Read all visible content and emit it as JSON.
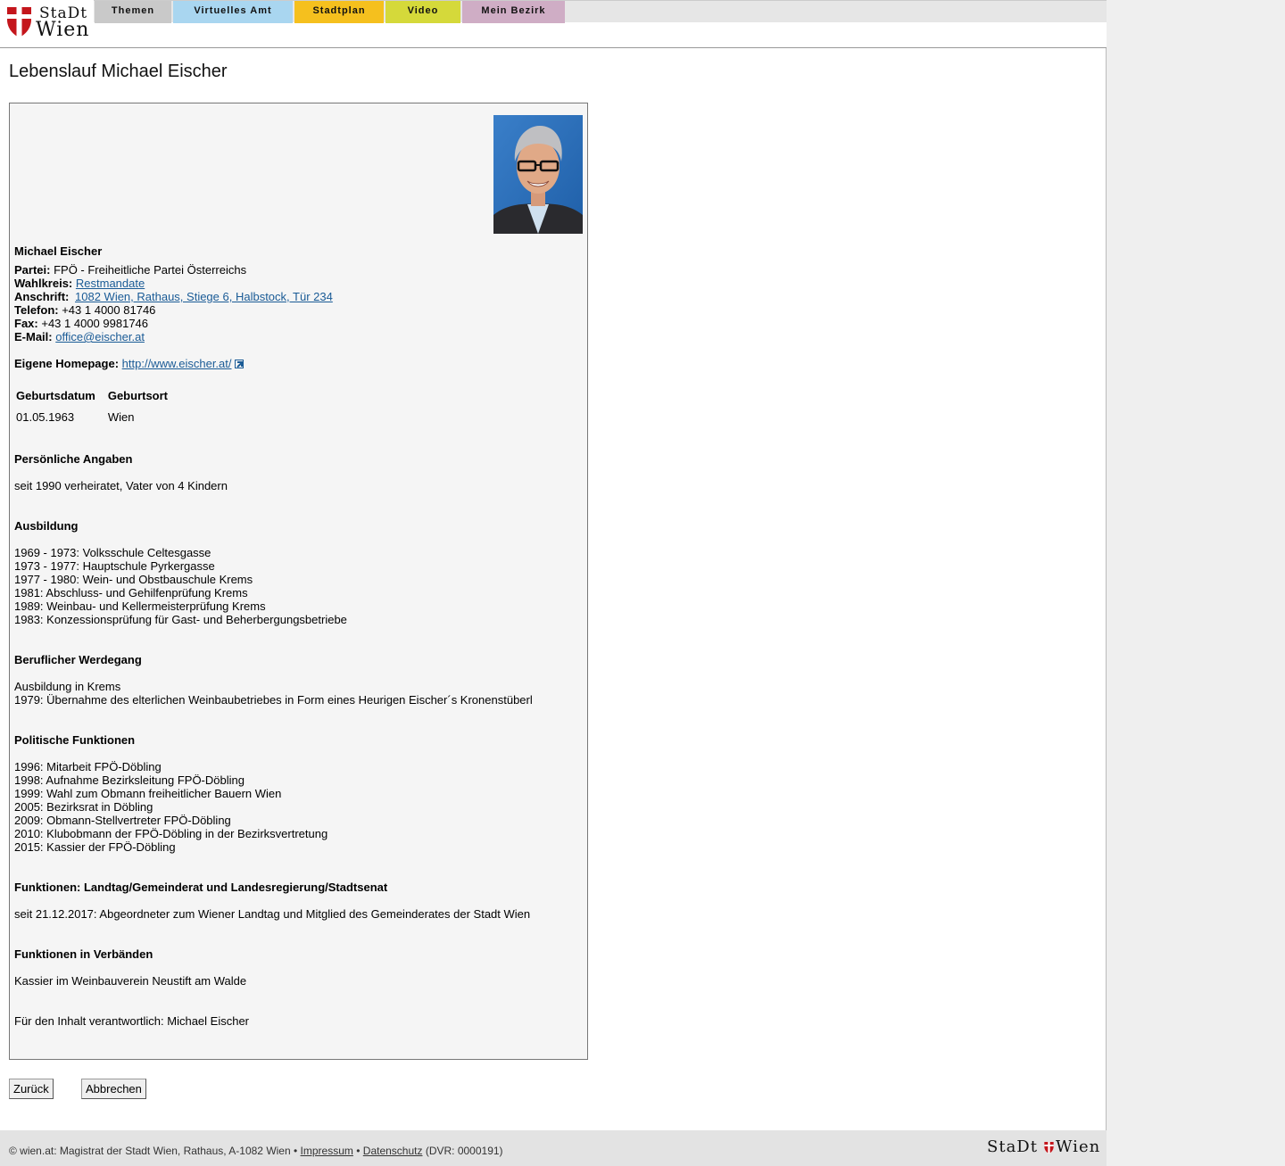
{
  "header": {
    "logo": {
      "line1": "StaDt",
      "line2": "Wien"
    },
    "tabs": [
      {
        "label": "Themen",
        "color": "#c9c9c9"
      },
      {
        "label": "Virtuelles Amt",
        "color": "#a9d6f0"
      },
      {
        "label": "Stadtplan",
        "color": "#f5c01e"
      },
      {
        "label": "Video",
        "color": "#d5d93a"
      },
      {
        "label": "Mein Bezirk",
        "color": "#cfadc5"
      }
    ]
  },
  "page": {
    "title": "Lebenslauf Michael Eischer"
  },
  "profile": {
    "name": "Michael Eischer",
    "partei_label": "Partei:",
    "partei": "FPÖ - Freiheitliche Partei Österreichs",
    "wahlkreis_label": "Wahlkreis:",
    "wahlkreis": "Restmandate",
    "anschrift_label": "Anschrift:",
    "anschrift": "1082 Wien, Rathaus, Stiege 6, Halbstock, Tür 234",
    "telefon_label": "Telefon:",
    "telefon": "+43 1 4000 81746",
    "fax_label": "Fax:",
    "fax": "+43 1 4000 9981746",
    "email_label": "E-Mail:",
    "email": "office@eischer.at",
    "homepage_label": "Eigene Homepage:",
    "homepage": "http://www.eischer.at/"
  },
  "birth": {
    "headers": [
      "Geburtsdatum",
      "Geburtsort"
    ],
    "values": [
      "01.05.1963",
      "Wien"
    ]
  },
  "sections": {
    "persoenlich": {
      "heading": "Persönliche Angaben",
      "lines": [
        "seit 1990 verheiratet, Vater von 4 Kindern"
      ]
    },
    "ausbildung": {
      "heading": "Ausbildung",
      "lines": [
        "1969 - 1973: Volksschule Celtesgasse",
        "1973 - 1977: Hauptschule Pyrkergasse",
        "1977 - 1980: Wein- und Obstbauschule Krems",
        "1981: Abschluss- und Gehilfenprüfung Krems",
        "1989: Weinbau- und Kellermeisterprüfung Krems",
        "1983: Konzessionsprüfung für Gast- und Beherbergungsbetriebe"
      ]
    },
    "beruf": {
      "heading": "Beruflicher Werdegang",
      "lines": [
        "Ausbildung in Krems",
        "1979: Übernahme des elterlichen Weinbaubetriebes in Form eines Heurigen Eischer´s Kronenstüberl"
      ]
    },
    "politik": {
      "heading": "Politische Funktionen",
      "lines": [
        "1996: Mitarbeit FPÖ-Döbling",
        "1998: Aufnahme Bezirksleitung FPÖ-Döbling",
        "1999: Wahl zum Obmann freiheitlicher Bauern Wien",
        "2005: Bezirksrat in Döbling",
        "2009: Obmann-Stellvertreter FPÖ-Döbling",
        "2010: Klubobmann der FPÖ-Döbling in der Bezirksvertretung",
        "2015: Kassier der FPÖ-Döbling"
      ]
    },
    "landtag": {
      "heading": "Funktionen: Landtag/Gemeinderat und Landesregierung/Stadtsenat",
      "lines": [
        "seit 21.12.2017: Abgeordneter zum Wiener Landtag und Mitglied des Gemeinderates der Stadt Wien"
      ]
    },
    "verbaende": {
      "heading": "Funktionen in Verbänden",
      "lines": [
        "Kassier im Weinbauverein Neustift am Walde"
      ]
    }
  },
  "responsible": "Für den Inhalt verantwortlich: Michael Eischer",
  "buttons": {
    "back": "Zurück",
    "cancel": "Abbrechen"
  },
  "footer": {
    "copyright": "© wien.at: Magistrat der Stadt Wien, Rathaus, A-1082 Wien •",
    "impressum": "Impressum",
    "sep": "•",
    "datenschutz": "Datenschutz",
    "dvr": "(DVR: 0000191)",
    "logo_left": "StaDt",
    "logo_right": "Wien"
  },
  "colors": {
    "link": "#1a5b96",
    "wien_red": "#c4161c"
  }
}
